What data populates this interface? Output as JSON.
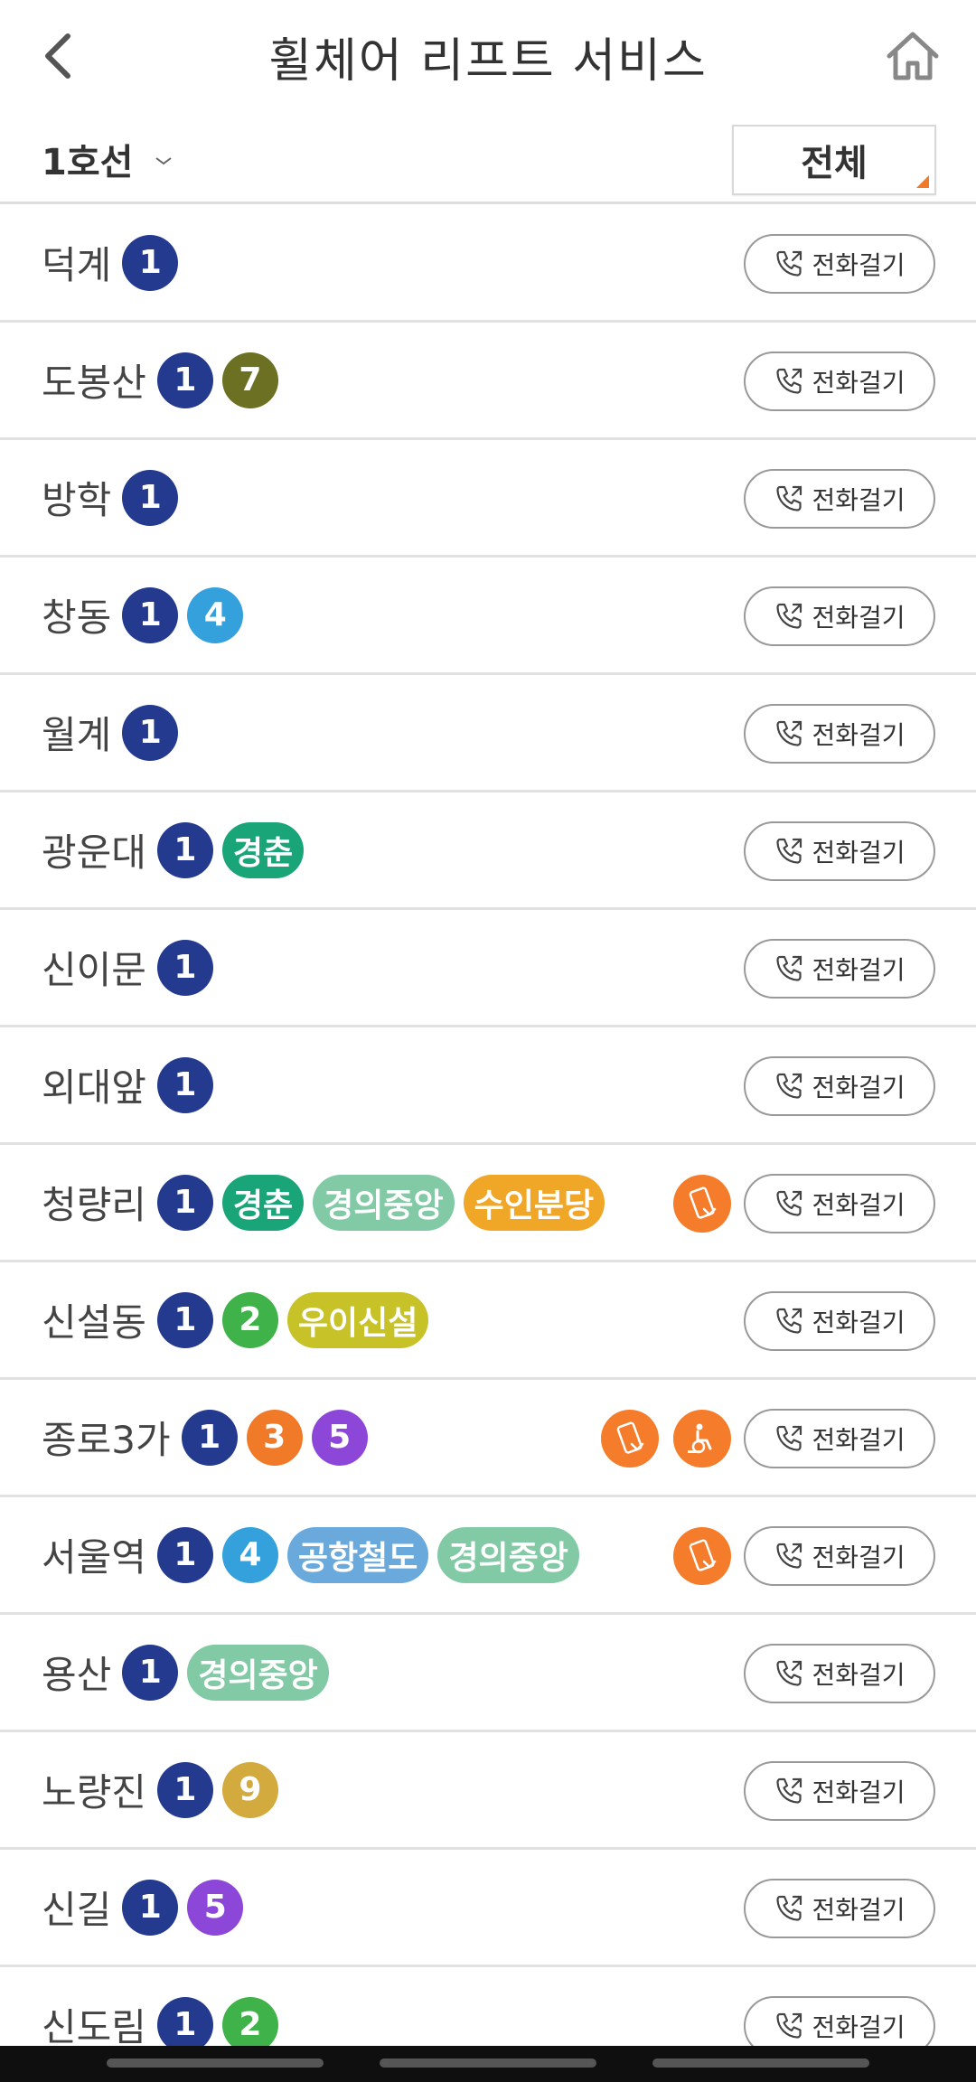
{
  "header": {
    "title": "휠체어 리프트 서비스",
    "back_icon": "chevron-left-icon",
    "home_icon": "home-icon"
  },
  "filter": {
    "line_label": "1호선",
    "all_label": "전체"
  },
  "call_label": "전화걸기",
  "colors": {
    "line1": "#243a8f",
    "line2": "#3fb34a",
    "line3": "#f07a28",
    "line4": "#34a0dc",
    "line5": "#8d47d8",
    "line7": "#6b7022",
    "line9": "#d2aa3e",
    "gyeongchun": "#1aa578",
    "gyeongui": "#82c9a5",
    "suinbundang": "#f0a626",
    "ui_sinseol": "#c6c227",
    "airport": "#69a9dc",
    "accent": "#f47c2b"
  },
  "stations": [
    {
      "name": "덕계",
      "lines": [
        {
          "label": "1",
          "color": "#243a8f"
        }
      ],
      "icons": []
    },
    {
      "name": "도봉산",
      "lines": [
        {
          "label": "1",
          "color": "#243a8f"
        },
        {
          "label": "7",
          "color": "#6b7022"
        }
      ],
      "icons": []
    },
    {
      "name": "방학",
      "lines": [
        {
          "label": "1",
          "color": "#243a8f"
        }
      ],
      "icons": []
    },
    {
      "name": "창동",
      "lines": [
        {
          "label": "1",
          "color": "#243a8f"
        },
        {
          "label": "4",
          "color": "#34a0dc"
        }
      ],
      "icons": []
    },
    {
      "name": "월계",
      "lines": [
        {
          "label": "1",
          "color": "#243a8f"
        }
      ],
      "icons": []
    },
    {
      "name": "광운대",
      "lines": [
        {
          "label": "1",
          "color": "#243a8f"
        },
        {
          "label": "경춘",
          "color": "#1aa578"
        }
      ],
      "icons": []
    },
    {
      "name": "신이문",
      "lines": [
        {
          "label": "1",
          "color": "#243a8f"
        }
      ],
      "icons": []
    },
    {
      "name": "외대앞",
      "lines": [
        {
          "label": "1",
          "color": "#243a8f"
        }
      ],
      "icons": []
    },
    {
      "name": "청량리",
      "lines": [
        {
          "label": "1",
          "color": "#243a8f"
        },
        {
          "label": "경춘",
          "color": "#1aa578"
        },
        {
          "label": "경의중앙",
          "color": "#82c9a5"
        },
        {
          "label": "수인분당",
          "color": "#f0a626"
        }
      ],
      "icons": [
        "phone-touch-icon"
      ]
    },
    {
      "name": "신설동",
      "lines": [
        {
          "label": "1",
          "color": "#243a8f"
        },
        {
          "label": "2",
          "color": "#3fb34a"
        },
        {
          "label": "우이신설",
          "color": "#c6c227"
        }
      ],
      "icons": []
    },
    {
      "name": "종로3가",
      "lines": [
        {
          "label": "1",
          "color": "#243a8f"
        },
        {
          "label": "3",
          "color": "#f07a28"
        },
        {
          "label": "5",
          "color": "#8d47d8"
        }
      ],
      "icons": [
        "phone-touch-icon",
        "wheelchair-lift-icon"
      ]
    },
    {
      "name": "서울역",
      "lines": [
        {
          "label": "1",
          "color": "#243a8f"
        },
        {
          "label": "4",
          "color": "#34a0dc"
        },
        {
          "label": "공항철도",
          "color": "#69a9dc"
        },
        {
          "label": "경의중앙",
          "color": "#82c9a5"
        }
      ],
      "icons": [
        "phone-touch-icon"
      ]
    },
    {
      "name": "용산",
      "lines": [
        {
          "label": "1",
          "color": "#243a8f"
        },
        {
          "label": "경의중앙",
          "color": "#82c9a5"
        }
      ],
      "icons": []
    },
    {
      "name": "노량진",
      "lines": [
        {
          "label": "1",
          "color": "#243a8f"
        },
        {
          "label": "9",
          "color": "#d2aa3e"
        }
      ],
      "icons": []
    },
    {
      "name": "신길",
      "lines": [
        {
          "label": "1",
          "color": "#243a8f"
        },
        {
          "label": "5",
          "color": "#8d47d8"
        }
      ],
      "icons": []
    },
    {
      "name": "신도림",
      "lines": [
        {
          "label": "1",
          "color": "#243a8f"
        },
        {
          "label": "2",
          "color": "#3fb34a"
        }
      ],
      "icons": []
    }
  ]
}
